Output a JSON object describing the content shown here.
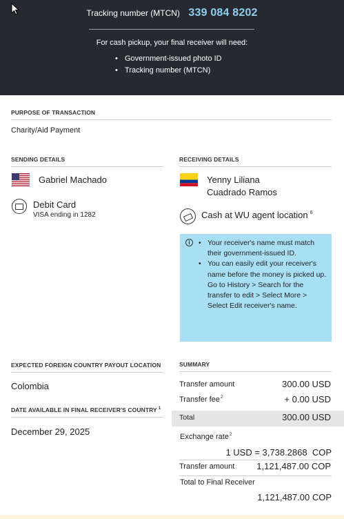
{
  "header": {
    "mtcn_label": "Tracking number (MTCN)",
    "mtcn_value": "339 084 8202",
    "pickup_intro": "For cash pickup, your final receiver will need:",
    "pickup_requirements": [
      "Government-issued photo ID",
      "Tracking number (MTCN)"
    ]
  },
  "purpose": {
    "label": "PURPOSE OF TRANSACTION",
    "value": "Charity/Aid Payment"
  },
  "sending": {
    "label": "SENDING DETAILS",
    "flag_icon": "us-flag-icon",
    "sender_name": "Gabriel Machado",
    "payment_icon": "credit-card-icon",
    "payment_method": "Debit Card",
    "payment_detail": "VISA ending in 1282"
  },
  "receiving": {
    "label": "RECEIVING DETAILS",
    "flag_icon": "colombia-flag-icon",
    "receiver_name_line1": "Yenny Liliana",
    "receiver_name_line2": "Cuadrado Ramos",
    "delivery_icon": "cash-hand-icon",
    "delivery_method": "Cash at WU agent location",
    "delivery_footnote": "6"
  },
  "info": {
    "icon": "info-icon",
    "notes": [
      "Your receiver's name must match their government-issued ID.",
      "You can easily edit your receiver's name before the money is picked up. Go to History > Search for the transfer to edit > Select More > Select Edit receiver's name."
    ]
  },
  "payout": {
    "label": "EXPECTED FOREIGN COUNTRY PAYOUT LOCATION",
    "value": "Colombia",
    "date_label": "DATE AVAILABLE IN FINAL RECEIVER'S COUNTRY",
    "date_footnote": "1",
    "date_value": "December 29, 2025"
  },
  "summary": {
    "label": "SUMMARY",
    "transfer_amount_label": "Transfer amount",
    "transfer_amount_value": "300.00 USD",
    "transfer_fee_label": "Transfer fee",
    "transfer_fee_footnote": "2",
    "transfer_fee_value": "+ 0.00 USD",
    "total_label": "Total",
    "total_value": "300.00 USD",
    "exchange_rate_label": "Exchange rate",
    "exchange_rate_footnote": "2",
    "exchange_rate_value": "1 USD = 3,738.2868  COP",
    "converted_amount_label": "Transfer amount",
    "converted_amount_value": "1,121,487.00 COP",
    "final_receiver_label": "Total to Final Receiver",
    "final_receiver_value": "1,121,487.00 COP"
  },
  "colors": {
    "header_bg": "#26292f",
    "mtcn_accent": "#8fd0ee",
    "info_bg": "#a9dff4",
    "total_row_bg": "#e6e6e6"
  }
}
